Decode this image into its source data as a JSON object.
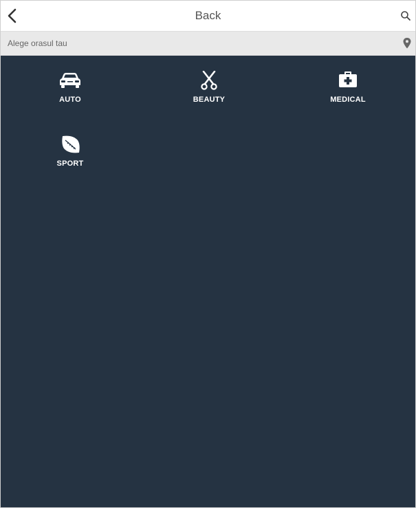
{
  "header": {
    "back_label": "Back",
    "icons": {
      "back": "chevron-left-icon",
      "search": "search-icon"
    }
  },
  "city": {
    "placeholder": "Alege orasul tau",
    "icon": "map-pin-icon"
  },
  "categories": [
    {
      "label": "AUTO",
      "icon": "car-icon"
    },
    {
      "label": "BEAUTY",
      "icon": "scissors-icon"
    },
    {
      "label": "MEDICAL",
      "icon": "medical-kit-icon"
    },
    {
      "label": "SPORT",
      "icon": "football-icon"
    }
  ],
  "colors": {
    "content_background": "#253342",
    "header_background": "#ffffff",
    "city_bar_background": "#e9e9e9"
  }
}
